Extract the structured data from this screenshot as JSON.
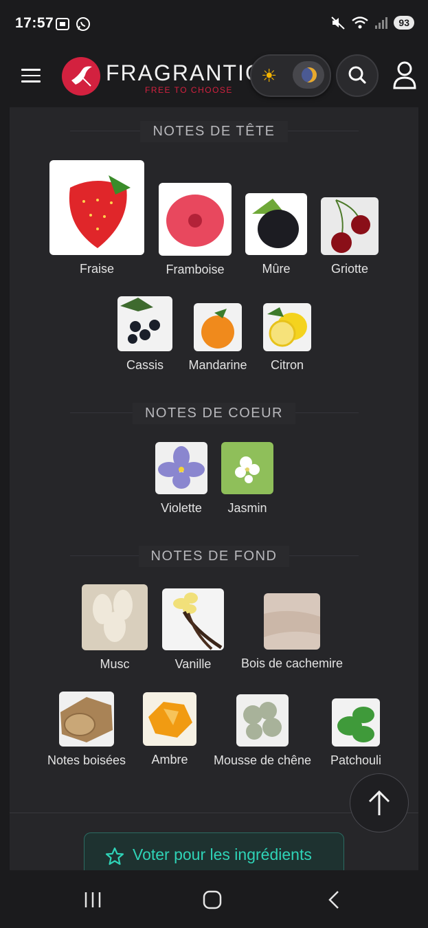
{
  "status": {
    "time": "17:57",
    "battery": "93"
  },
  "header": {
    "logo_text": "FRAGRANTICA",
    "logo_tagline": "FREE TO CHOOSE"
  },
  "sections": {
    "top": {
      "title": "NOTES DE TÊTE",
      "notes": [
        {
          "label": "Fraise",
          "icon": "strawberry-icon"
        },
        {
          "label": "Framboise",
          "icon": "raspberry-icon"
        },
        {
          "label": "Mûre",
          "icon": "blackberry-icon"
        },
        {
          "label": "Griotte",
          "icon": "cherry-icon"
        },
        {
          "label": "Cassis",
          "icon": "blackcurrant-icon"
        },
        {
          "label": "Mandarine",
          "icon": "mandarin-icon"
        },
        {
          "label": "Citron",
          "icon": "lemon-icon"
        }
      ]
    },
    "heart": {
      "title": "NOTES DE COEUR",
      "notes": [
        {
          "label": "Violette",
          "icon": "violet-icon"
        },
        {
          "label": "Jasmin",
          "icon": "jasmine-icon"
        }
      ]
    },
    "base": {
      "title": "NOTES DE FOND",
      "notes": [
        {
          "label": "Musc",
          "icon": "musk-icon"
        },
        {
          "label": "Vanille",
          "icon": "vanilla-icon"
        },
        {
          "label": "Bois de cachemire",
          "icon": "cashmere-wood-icon"
        },
        {
          "label": "Notes boisées",
          "icon": "wood-icon"
        },
        {
          "label": "Ambre",
          "icon": "amber-icon"
        },
        {
          "label": "Mousse de chêne",
          "icon": "oakmoss-icon"
        },
        {
          "label": "Patchouli",
          "icon": "patchouli-icon"
        }
      ]
    }
  },
  "vote_button": {
    "label": "Voter pour les ingrédients"
  },
  "colors": {
    "accent": "#2fd3b7",
    "brand": "#d3213f",
    "background": "#1b1b1d",
    "card": "#262629"
  }
}
